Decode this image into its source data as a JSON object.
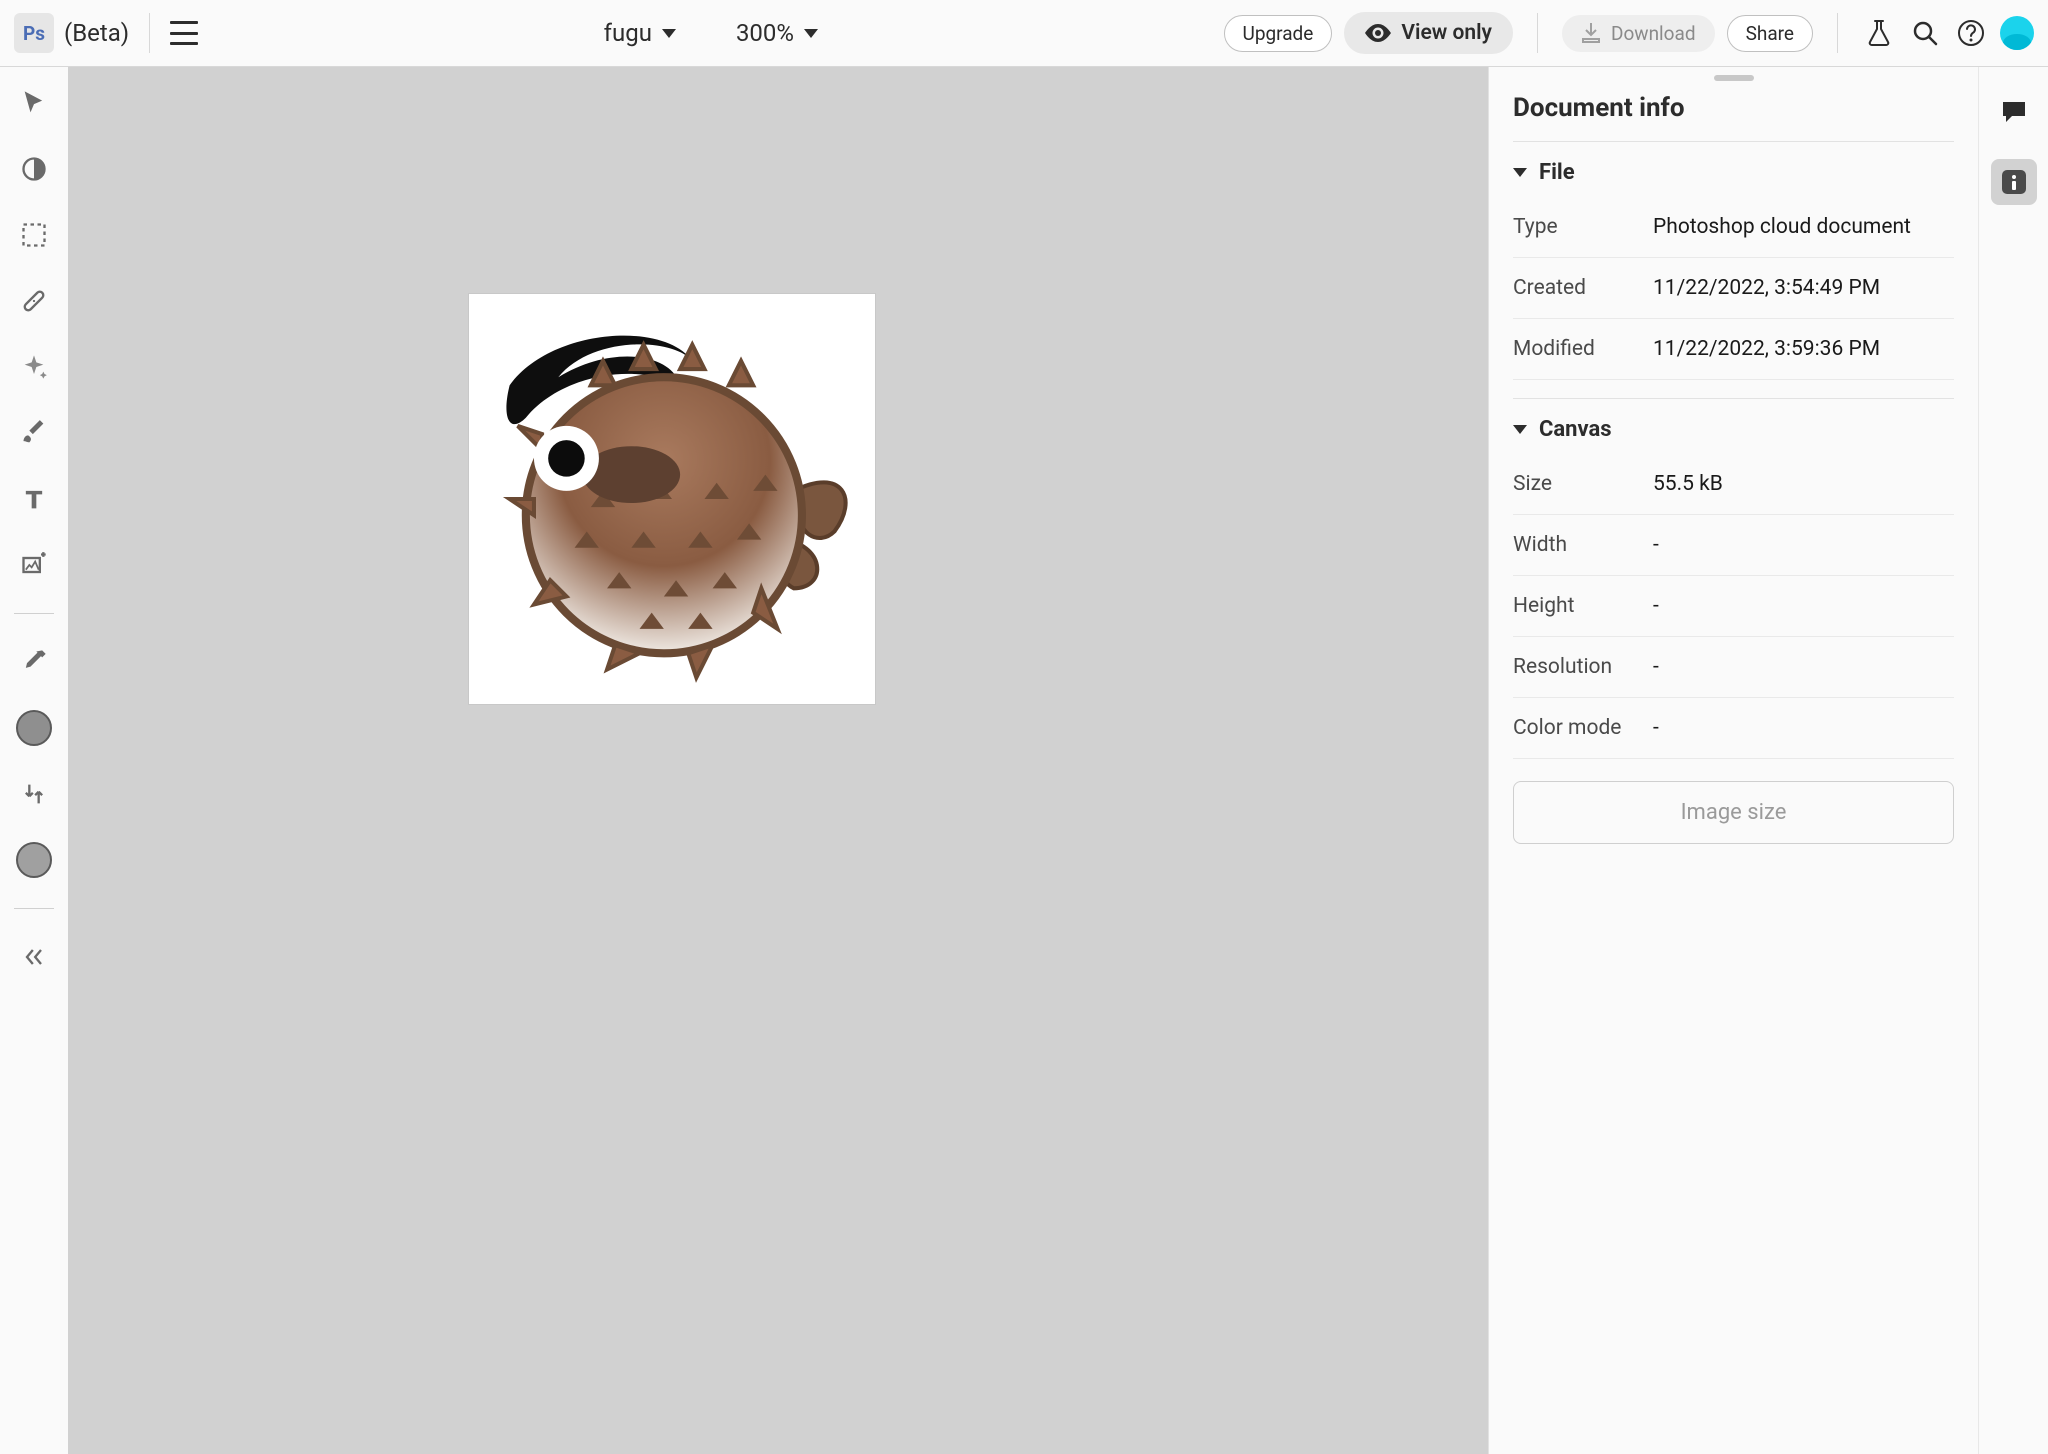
{
  "header": {
    "logo_text": "Ps",
    "beta_label": "(Beta)",
    "doc_name": "fugu",
    "zoom": "300%",
    "upgrade_label": "Upgrade",
    "view_only_label": "View only",
    "download_label": "Download",
    "share_label": "Share"
  },
  "doc_info": {
    "title": "Document info",
    "file_section": "File",
    "canvas_section": "Canvas",
    "type_label": "Type",
    "type_value": "Photoshop cloud document",
    "created_label": "Created",
    "created_value": "11/22/2022, 3:54:49 PM",
    "modified_label": "Modified",
    "modified_value": "11/22/2022, 3:59:36 PM",
    "size_label": "Size",
    "size_value": "55.5 kB",
    "width_label": "Width",
    "width_value": "-",
    "height_label": "Height",
    "height_value": "-",
    "resolution_label": "Resolution",
    "resolution_value": "-",
    "colormode_label": "Color mode",
    "colormode_value": "-",
    "image_size_button": "Image size"
  }
}
